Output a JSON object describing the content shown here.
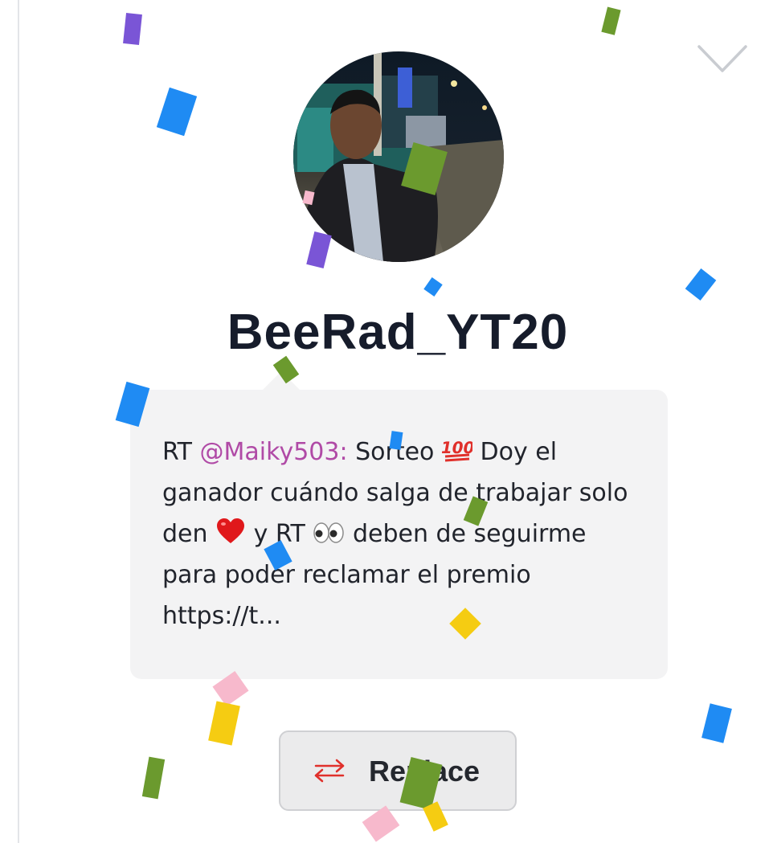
{
  "profile": {
    "username": "BeeRad_YT20",
    "avatar": "avatar-photo"
  },
  "tweet": {
    "prefix": "RT ",
    "mention": "@Maiky503:",
    "segment_1": " Sorteo ",
    "segment_2": " Doy el ganador cuándo salga de trabajar solo den ",
    "segment_3": " y RT ",
    "segment_4": " deben de seguirme para poder reclamar el premio https://t..."
  },
  "icons": {
    "collapse": "chevron-down-icon",
    "replace": "swap-arrows-icon",
    "emoji_1": "hundred-points-emoji",
    "emoji_2": "red-heart-emoji",
    "emoji_3": "eyes-emoji"
  },
  "actions": {
    "replace_label": "Replace"
  },
  "colors": {
    "mention": "#b04aa6",
    "username": "#161c2b",
    "replace_icon": "#e0302b",
    "bubble": "#f3f3f4"
  }
}
